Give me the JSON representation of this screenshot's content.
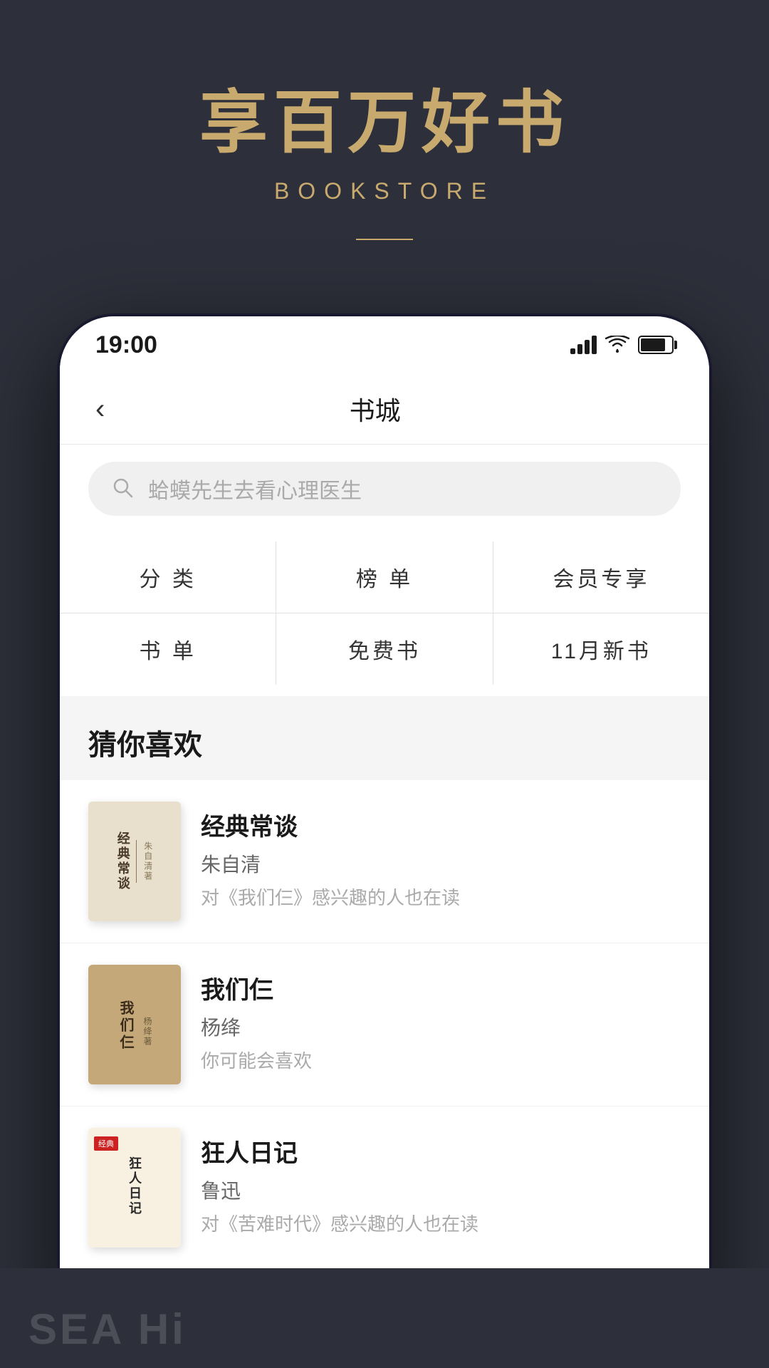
{
  "header": {
    "title_cn": "享百万好书",
    "title_en": "BOOKSTORE"
  },
  "status_bar": {
    "time": "19:00"
  },
  "nav": {
    "title": "书城",
    "back_label": "‹"
  },
  "search": {
    "placeholder": "蛤蟆先生去看心理医生"
  },
  "categories": [
    {
      "label": "分  类"
    },
    {
      "label": "榜  单"
    },
    {
      "label": "会员专享"
    },
    {
      "label": "书  单"
    },
    {
      "label": "免费书"
    },
    {
      "label": "11月新书"
    }
  ],
  "recommend": {
    "section_title": "猜你喜欢",
    "books": [
      {
        "name": "经典常谈",
        "author": "朱自清",
        "desc": "对《我们仨》感兴趣的人也在读",
        "cover_text": "经典常谈",
        "cover_subtitle": "朱自清"
      },
      {
        "name": "我们仨",
        "author": "杨绛",
        "desc": "你可能会喜欢",
        "cover_text": "我们仨",
        "cover_author": "杨绛"
      },
      {
        "name": "狂人日记",
        "author": "鲁迅",
        "desc": "对《苦难时代》感兴趣的人也在读",
        "cover_text": "狂人日记",
        "cover_label": "狂人日记"
      }
    ]
  },
  "bottom": {
    "text": "SEA Hi"
  }
}
